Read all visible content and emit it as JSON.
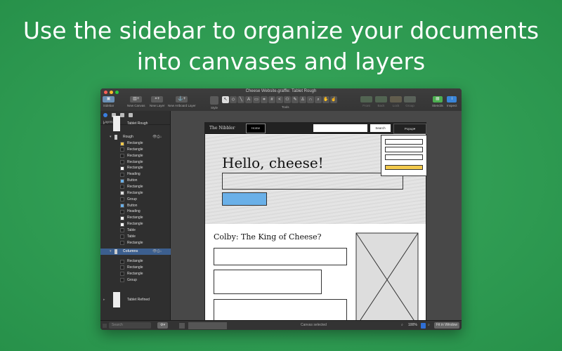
{
  "headline": {
    "line1": "Use the sidebar to organize your documents",
    "line2": "into canvases and layers"
  },
  "window": {
    "title": "Cheese Website.graffle: Tablet Rough"
  },
  "toolbar": {
    "sidebar": "Sidebar",
    "new_canvas": "New Canvas",
    "new_layer": "New Layer",
    "new_artboard_layer": "New Artboard Layer",
    "style": "Style",
    "tools": "Tools",
    "front": "Front",
    "back": "Back",
    "lock": "Lock",
    "group": "Group",
    "stencils": "Stencils",
    "inspect": "Inspect"
  },
  "sidebar": {
    "layers_label": "Layers",
    "search_placeholder": "Search",
    "canvas1": "Tablet Rough",
    "layer1": "Rough",
    "items1": [
      "Rectangle",
      "Rectangle",
      "Rectangle",
      "Rectangle",
      "Rectangle",
      "Heading",
      "Button",
      "Rectangle",
      "Rectangle",
      "Group",
      "Button",
      "Heading",
      "Rectangle",
      "Rectangle",
      "Table",
      "Table",
      "Rectangle"
    ],
    "layer2": "Columns",
    "items2": [
      "Rectangle",
      "Rectangle",
      "Rectangle",
      "Group"
    ],
    "canvas2": "Tablet Refined"
  },
  "mockup": {
    "brand": "The Nibbler",
    "home": "Home",
    "search_btn": "Search",
    "popup": "Popup▾",
    "hero_title": "Hello, cheese!",
    "section_title": "Colby: The King of Cheese?"
  },
  "status": {
    "text": "Canvas selected",
    "zoom": "100%",
    "fit": "Fit in Window"
  },
  "colors": {
    "background": "#2e9c50",
    "selection": "#3c5f8f",
    "accent_blue": "#6ab0e8",
    "accent_yellow": "#f2c94c"
  }
}
